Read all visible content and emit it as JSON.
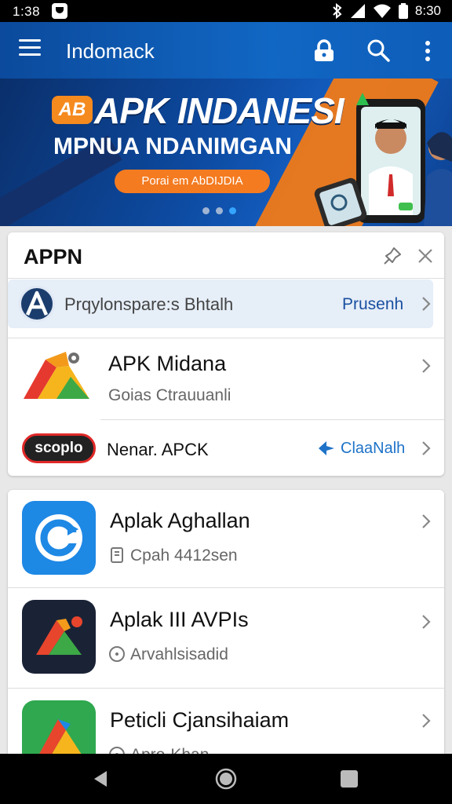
{
  "status_bar": {
    "time_left": "1:38",
    "time_right": "8:30"
  },
  "app_bar": {
    "title": "Indomack"
  },
  "banner": {
    "logo_text": "AB",
    "title": "APK INDANESI",
    "subtitle": "MPNUA NDANIMGAN",
    "button_label": "Porai em AbDIJDIA",
    "page_count": 3,
    "active_page": 3
  },
  "section": {
    "title": "APPN",
    "highlight": {
      "icon_letter": "A",
      "text": "Prqylonspare:s Bhtalh",
      "action": "Prusenh"
    },
    "featured": {
      "title": "APK Midana",
      "subtitle": "Goias Ctrauuanli"
    },
    "promo": {
      "badge": "scoplo",
      "text": "Nenar. APCK",
      "action": "ClaaNalh"
    }
  },
  "apps": [
    {
      "title": "Aplak Aghallan",
      "meta": "Cpah 4412sen",
      "meta_icon": "phone-icon",
      "icon_color": "#1e88e5"
    },
    {
      "title": "Aplak III AVPIs",
      "meta": "Arvahlsisadid",
      "meta_icon": "clock-icon",
      "icon_color": "#1a2336"
    },
    {
      "title": "Peticli Cjansihaiam",
      "meta": "Apro-Khan",
      "meta_icon": "clock-icon",
      "icon_color": "#2fa84f"
    }
  ],
  "colors": {
    "app_bar": "#1167c4",
    "accent_orange": "#f47b20",
    "link_blue": "#1a4fa0"
  }
}
